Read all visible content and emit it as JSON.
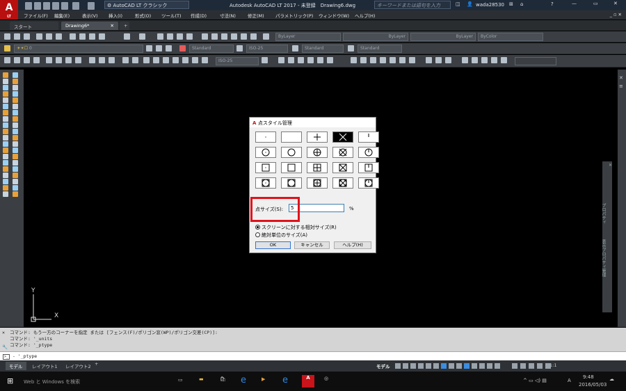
{
  "titlebar": {
    "app_letter": "A",
    "app_sub": "LT",
    "workspace": "AutoCAD LT クラシック",
    "title": "Autodesk AutoCAD LT 2017 - 未登録　Drawing6.dwg",
    "search_placeholder": "キーワードまたは語句を入力",
    "user": "wada28530"
  },
  "menus": [
    "ファイル(F)",
    "編集(E)",
    "表示(V)",
    "挿入(I)",
    "形式(O)",
    "ツール(T)",
    "作成(D)",
    "寸法(N)",
    "修正(M)",
    "パラメトリック(P)",
    "ウィンドウ(W)",
    "ヘルプ(H)"
  ],
  "tabs": [
    "スタート",
    "Drawing6*"
  ],
  "layer_dropdowns": [
    "ByLayer",
    "ByLayer",
    "ByLayer",
    "ByColor"
  ],
  "style_dropdowns": [
    "Standard",
    "ISO-25",
    "Standard",
    "Standard"
  ],
  "layer_name": "0",
  "dim_style": "ISO-25",
  "dialog": {
    "title": "点スタイル管理",
    "size_label": "点サイズ(S):",
    "size_value": "5",
    "size_unit": "%",
    "radio_relative": "スクリーンに対する相対サイズ(R)",
    "radio_absolute": "絶対単位のサイズ(A)",
    "relative_selected": true,
    "ok": "OK",
    "cancel": "キャンセル",
    "help": "ヘルプ(H)",
    "selected_point_style": "X"
  },
  "ucs": {
    "x": "X",
    "y": "Y"
  },
  "command": {
    "history": [
      "コマンド: もう一方のコーナーを指定 または [フェンス(F)/ポリゴン窓(WP)/ポリゴン交差(CP)]:",
      "コマンド: '_units",
      "コマンド: '_ptype"
    ],
    "input": "- '_ptype"
  },
  "layout_tabs": [
    "モデル",
    "レイアウト1",
    "レイアウト2"
  ],
  "status": {
    "model": "モデル",
    "scale": "1:1"
  },
  "properties_label": "プロパティ",
  "properties_label2": "表示プロパティ管理",
  "taskbar": {
    "search": "Web と Windows を検索",
    "time": "9:48",
    "date": "2016/05/03",
    "ime": "A"
  }
}
